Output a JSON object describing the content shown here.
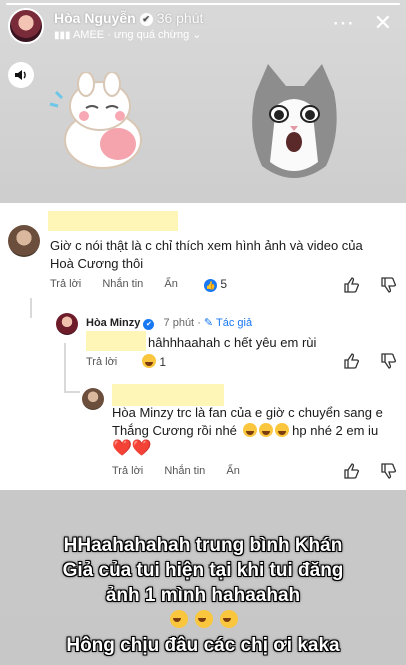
{
  "header": {
    "user_name": "Hòa Nguyễn",
    "time": "36 phút",
    "music_artist": "AMEE",
    "music_song": "ưng quá chừng",
    "music_separator": "·"
  },
  "comment_1": {
    "text": "Giờ c nói thật là c chỉ thích xem hình ảnh và video của Hoà Cương thôi",
    "reply": "Trả lời",
    "message": "Nhắn tin",
    "hide": "Ẩn",
    "reaction_count": "5"
  },
  "reply_1": {
    "author": "Hòa Minzy",
    "time": "7 phút",
    "author_badge": "Tác giả",
    "text": "hâhhhaahah c hết yêu em rùi",
    "reply": "Trả lời",
    "reaction_count": "1"
  },
  "reply_2": {
    "text_line1": "Hòa Minzy trc là fan của e giờ c chuyển sang e",
    "text_line2": "Thắng Cương rồi nhé",
    "text_suffix": "hp nhé 2 em iu",
    "hearts": "❤️❤️",
    "reply": "Trả lời",
    "message": "Nhắn tin",
    "hide": "Ẩn"
  },
  "caption": {
    "line1": "HHaahahahah trung bình Khán",
    "line2": "Giả của tui hiện tại khi tui đăng",
    "line3": "ảnh 1 mình hahaahah",
    "line5": "Hông chịu đâu các chị ơi kaka"
  },
  "icons": [
    "sound-icon",
    "more-icon",
    "close-icon",
    "music-note-icon",
    "verified-icon",
    "like-icon",
    "dislike-icon",
    "laugh-emoji-icon",
    "heart-icon"
  ],
  "story_progress": 1.0
}
